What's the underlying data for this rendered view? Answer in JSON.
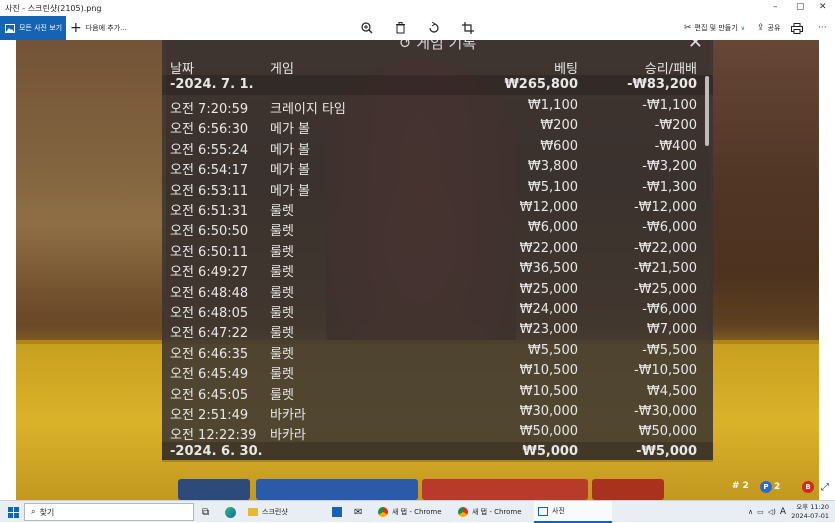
{
  "window": {
    "title": "사진 - 스크린샷(2105).png",
    "controls": {
      "minimize": "–",
      "maximize": "▢",
      "close": "✕"
    }
  },
  "toolbar": {
    "all_photos": "모든 사진 보기",
    "add_to": "다음에 추가...",
    "edit_create": "편집 및 만들기",
    "share": "공유",
    "more": "···"
  },
  "panel": {
    "title": "게임 기록",
    "headers": {
      "date": "날짜",
      "game": "게임",
      "bet": "베팅",
      "wl": "승리/패배"
    },
    "date_top": {
      "date": "-2024. 7. 1.",
      "bet": "₩265,800",
      "wl": "-₩83,200"
    },
    "rows": [
      {
        "time": "오전 7:20:59",
        "game": "크레이지 타임",
        "bet": "₩1,100",
        "wl": "-₩1,100"
      },
      {
        "time": "오전 6:56:30",
        "game": "메가 볼",
        "bet": "₩200",
        "wl": "-₩200"
      },
      {
        "time": "오전 6:55:24",
        "game": "메가 볼",
        "bet": "₩600",
        "wl": "-₩400"
      },
      {
        "time": "오전 6:54:17",
        "game": "메가 볼",
        "bet": "₩3,800",
        "wl": "-₩3,200"
      },
      {
        "time": "오전 6:53:11",
        "game": "메가 볼",
        "bet": "₩5,100",
        "wl": "-₩1,300"
      },
      {
        "time": "오전 6:51:31",
        "game": "룰렛",
        "bet": "₩12,000",
        "wl": "-₩12,000"
      },
      {
        "time": "오전 6:50:50",
        "game": "룰렛",
        "bet": "₩6,000",
        "wl": "-₩6,000"
      },
      {
        "time": "오전 6:50:11",
        "game": "룰렛",
        "bet": "₩22,000",
        "wl": "-₩22,000"
      },
      {
        "time": "오전 6:49:27",
        "game": "룰렛",
        "bet": "₩36,500",
        "wl": "-₩21,500"
      },
      {
        "time": "오전 6:48:48",
        "game": "룰렛",
        "bet": "₩25,000",
        "wl": "-₩25,000"
      },
      {
        "time": "오전 6:48:05",
        "game": "룰렛",
        "bet": "₩24,000",
        "wl": "-₩6,000"
      },
      {
        "time": "오전 6:47:22",
        "game": "룰렛",
        "bet": "₩23,000",
        "wl": "₩7,000"
      },
      {
        "time": "오전 6:46:35",
        "game": "룰렛",
        "bet": "₩5,500",
        "wl": "-₩5,500"
      },
      {
        "time": "오전 6:45:49",
        "game": "룰렛",
        "bet": "₩10,500",
        "wl": "-₩10,500"
      },
      {
        "time": "오전 6:45:05",
        "game": "룰렛",
        "bet": "₩10,500",
        "wl": "₩4,500"
      },
      {
        "time": "오전 2:51:49",
        "game": "바카라",
        "bet": "₩30,000",
        "wl": "-₩30,000"
      },
      {
        "time": "오전 12:22:39",
        "game": "바카라",
        "bet": "₩50,000",
        "wl": "₩50,000"
      }
    ],
    "date_bottom": {
      "date": "-2024. 6. 30.",
      "bet": "₩5,000",
      "wl": "-₩5,000"
    }
  },
  "game_stats": {
    "count_a": "# 2",
    "p_label": "P",
    "p_count": "2",
    "b_label": "B"
  },
  "taskbar": {
    "search_placeholder": "찾기",
    "items": [
      {
        "label": "스크린샷"
      },
      {
        "label": "새 탭 - Chrome"
      },
      {
        "label": "새 탭 - Chrome"
      },
      {
        "label": "사진"
      }
    ],
    "lang": "A",
    "time": "오후 11:20",
    "date": "2024-07-01"
  },
  "colors": {
    "accent": "#1464b4",
    "panel_bg": "#3a3432",
    "felt": "#d7ac26"
  }
}
